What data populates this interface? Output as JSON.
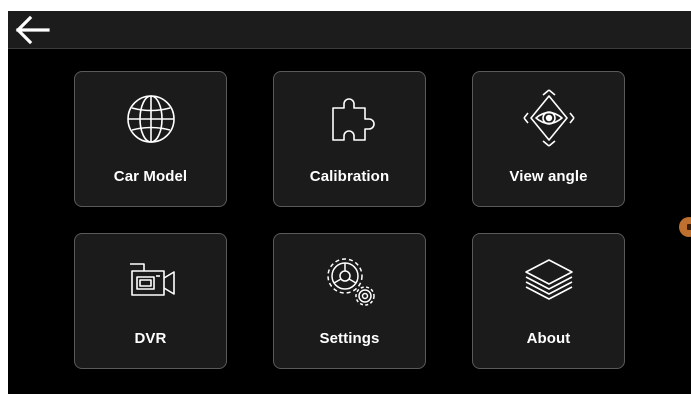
{
  "topbar": {
    "back_icon": "arrow-left-icon"
  },
  "menu": {
    "items": [
      {
        "label": "Car Model",
        "icon": "globe-icon"
      },
      {
        "label": "Calibration",
        "icon": "puzzle-icon"
      },
      {
        "label": "View angle",
        "icon": "eye-view-icon"
      },
      {
        "label": "DVR",
        "icon": "video-camera-icon"
      },
      {
        "label": "Settings",
        "icon": "gears-icon"
      },
      {
        "label": "About",
        "icon": "layers-icon"
      }
    ]
  },
  "colors": {
    "screen_background": "#000000",
    "topbar_background": "#1c1c1c",
    "tile_background": "#1b1b1b",
    "tile_border": "#5a5a5a",
    "text": "#ffffff",
    "side_handle": "#c0702e"
  }
}
